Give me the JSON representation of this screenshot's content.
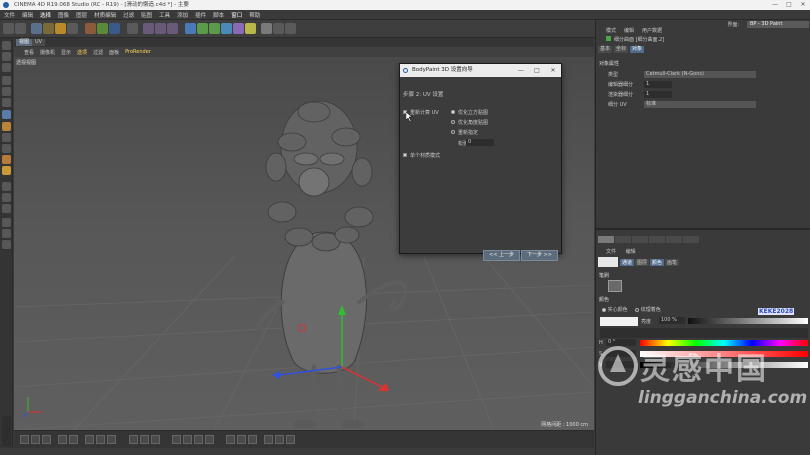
{
  "window": {
    "title": "CINEMA 4D R19.068 Studio (RC - R19) - [滑动的懒造.c4d *] - 主要",
    "controls": [
      "—",
      "□",
      "✕"
    ]
  },
  "menubar": {
    "items": [
      "文件",
      "编辑",
      "选择",
      "图像",
      "图层",
      "材质编辑",
      "过滤",
      "贴图",
      "工具",
      "添加",
      "插件",
      "脚本",
      "窗口",
      "帮助"
    ],
    "highlighted": "选择"
  },
  "layout": {
    "label": "界面:",
    "value": "BP - 3D Paint"
  },
  "viewport": {
    "tabs": [
      "视图",
      "UV"
    ],
    "menu": [
      "查看",
      "摄像机",
      "显示",
      "选项",
      "过滤",
      "面板",
      "ProRender"
    ],
    "label": "透视视图",
    "grid_info": "网格间距 : 1000 cm"
  },
  "dialog": {
    "title": "BodyPaint 3D 设置向导",
    "controls": [
      "—",
      "□",
      "✕"
    ],
    "step": "步骤 2: UV 设置",
    "recalc_uv_label": "重新计算 UV",
    "options": [
      "优化立方贴图",
      "优化角度贴图",
      "重新指定"
    ],
    "relax_label": "松弛",
    "relax_value": "0",
    "single_material_label": "单个材质模式",
    "back_button": "<< 上一步",
    "next_button": "下一步 >>"
  },
  "attributes": {
    "menu": [
      "模式",
      "编辑",
      "用户数据"
    ],
    "object_header": "细分曲面 [细分曲面.2]",
    "tabs": [
      "基本",
      "坐标",
      "对象"
    ],
    "section_title": "对象属性",
    "properties": [
      {
        "label": "类型",
        "value": "Catmull-Clark (N-Gons)"
      },
      {
        "label": "编辑器细分",
        "value": "1"
      },
      {
        "label": "渲染器细分",
        "value": "1"
      },
      {
        "label": "细分 UV",
        "value": "标准"
      }
    ]
  },
  "bodypaint": {
    "menu": [
      "文件",
      "编辑"
    ],
    "mode_buttons": [
      "通道",
      "图层",
      "颜色",
      "画笔"
    ],
    "brush_section": "笔刷",
    "color_section": "颜色",
    "color_option_1": "实心颜色",
    "color_option_2": "纹理着色",
    "opacity_label": "亮度",
    "opacity_value": "100 %",
    "h_label": "H",
    "h_value": "0 °",
    "s_label": "S",
    "v_label": "V",
    "keke_tag": "KEKE2028"
  },
  "watermark": {
    "chinese": "灵感中国",
    "english": "lingganchina.com"
  }
}
